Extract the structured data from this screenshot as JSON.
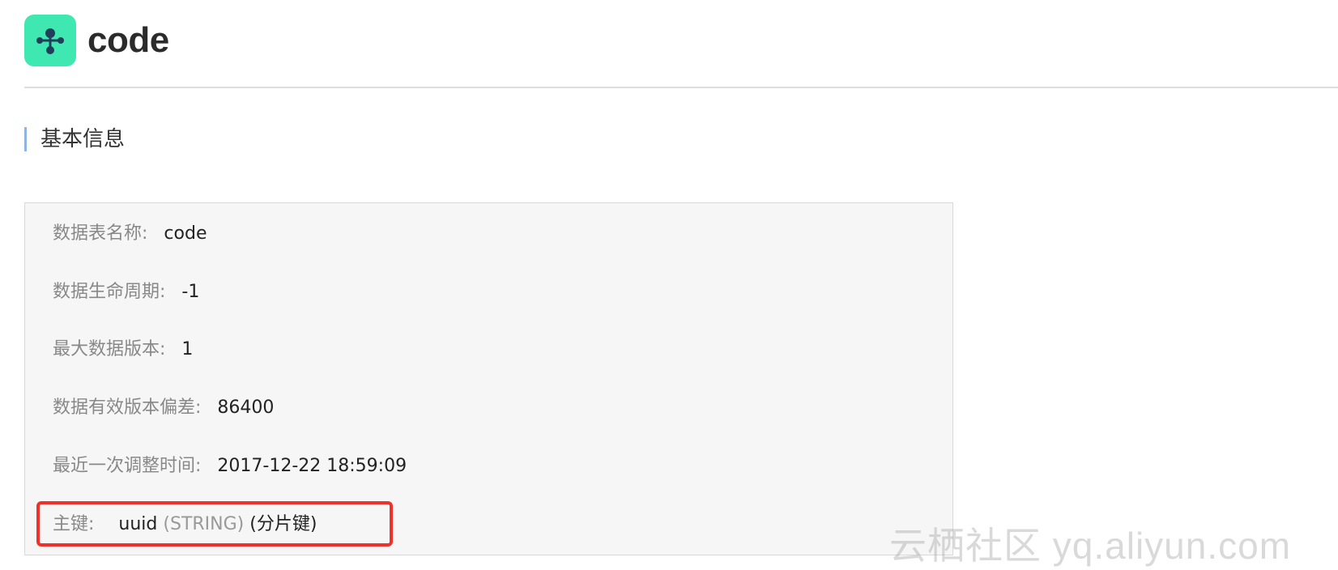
{
  "header": {
    "title": "code",
    "logo_icon": "share-node-icon",
    "accent": "#3fe8b0"
  },
  "section": {
    "title": "基本信息",
    "bar_color": "#8fb4e3"
  },
  "info": {
    "table_name": {
      "label": "数据表名称:",
      "value": "code"
    },
    "lifecycle": {
      "label": "数据生命周期:",
      "value": "-1"
    },
    "max_versions": {
      "label": "最大数据版本:",
      "value": "1"
    },
    "version_offset": {
      "label": "数据有效版本偏差:",
      "value": "86400"
    },
    "last_modified": {
      "label": "最近一次调整时间:",
      "value": "2017-12-22 18:59:09"
    },
    "primary_key": {
      "label": "主键:",
      "name": "uuid",
      "type": "(STRING)",
      "note": "(分片键)"
    }
  },
  "highlight_color": "#f0302a",
  "watermark": "云栖社区 yq.aliyun.com"
}
